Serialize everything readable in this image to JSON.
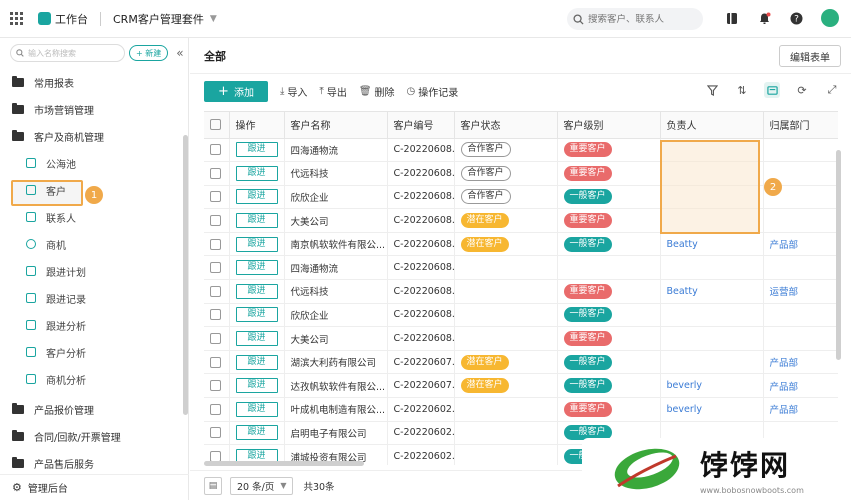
{
  "topbar": {
    "app_name": "工作台",
    "suite_name": "CRM客户管理套件",
    "search_placeholder": "搜索客户、联系人"
  },
  "sidebar": {
    "search_placeholder": "输入名称搜索",
    "new_label": "+ 新建",
    "items": [
      {
        "label": "常用报表",
        "type": "folder"
      },
      {
        "label": "市场营销管理",
        "type": "folder"
      },
      {
        "label": "客户及商机管理",
        "type": "folder"
      },
      {
        "label": "公海池",
        "type": "sub"
      },
      {
        "label": "客户",
        "type": "sub"
      },
      {
        "label": "联系人",
        "type": "sub"
      },
      {
        "label": "商机",
        "type": "sub"
      },
      {
        "label": "跟进计划",
        "type": "sub"
      },
      {
        "label": "跟进记录",
        "type": "sub"
      },
      {
        "label": "跟进分析",
        "type": "sub"
      },
      {
        "label": "客户分析",
        "type": "sub"
      },
      {
        "label": "商机分析",
        "type": "sub"
      },
      {
        "label": "产品报价管理",
        "type": "folder"
      },
      {
        "label": "合同/回款/开票管理",
        "type": "folder"
      },
      {
        "label": "产品售后服务",
        "type": "folder"
      }
    ],
    "bottom_label": "管理后台",
    "marker_1": "1"
  },
  "main": {
    "title": "全部",
    "edit_form_label": "编辑表单",
    "marker_2": "2"
  },
  "toolbar": {
    "add_label": "添加",
    "import_label": "导入",
    "export_label": "导出",
    "delete_label": "删除",
    "log_label": "操作记录"
  },
  "table": {
    "headers": [
      "操作",
      "客户名称",
      "客户编号",
      "客户状态",
      "客户级别",
      "负责人",
      "归属部门"
    ],
    "follow_label": "跟进",
    "rows": [
      {
        "name": "四海通物流",
        "code": "C-20220608...",
        "status": "合作客户",
        "status_style": "outline",
        "level": "重要客户",
        "level_style": "red",
        "owner": "",
        "dept": ""
      },
      {
        "name": "代远科技",
        "code": "C-20220608...",
        "status": "合作客户",
        "status_style": "outline",
        "level": "重要客户",
        "level_style": "red",
        "owner": "",
        "dept": ""
      },
      {
        "name": "欣欣企业",
        "code": "C-20220608...",
        "status": "合作客户",
        "status_style": "outline",
        "level": "一般客户",
        "level_style": "green",
        "owner": "",
        "dept": ""
      },
      {
        "name": "大美公司",
        "code": "C-20220608...",
        "status": "潜在客户",
        "status_style": "yellow",
        "level": "重要客户",
        "level_style": "red",
        "owner": "",
        "dept": ""
      },
      {
        "name": "南京帆软软件有限公...",
        "code": "C-20220608...",
        "status": "潜在客户",
        "status_style": "yellow",
        "level": "一般客户",
        "level_style": "green",
        "owner": "Beatty",
        "dept": "产品部"
      },
      {
        "name": "四海通物流",
        "code": "C-20220608...",
        "status": "",
        "status_style": "",
        "level": "",
        "level_style": "",
        "owner": "",
        "dept": ""
      },
      {
        "name": "代远科技",
        "code": "C-20220608...",
        "status": "",
        "status_style": "",
        "level": "重要客户",
        "level_style": "red",
        "owner": "Beatty",
        "dept": "运营部"
      },
      {
        "name": "欣欣企业",
        "code": "C-20220608...",
        "status": "",
        "status_style": "",
        "level": "一般客户",
        "level_style": "green",
        "owner": "",
        "dept": ""
      },
      {
        "name": "大美公司",
        "code": "C-20220608...",
        "status": "",
        "status_style": "",
        "level": "重要客户",
        "level_style": "red",
        "owner": "",
        "dept": ""
      },
      {
        "name": "湖滨大利药有限公司",
        "code": "C-20220607...",
        "status": "潜在客户",
        "status_style": "yellow",
        "level": "一般客户",
        "level_style": "green",
        "owner": "",
        "dept": "产品部"
      },
      {
        "name": "达孜帆软软件有限公...",
        "code": "C-20220607...",
        "status": "潜在客户",
        "status_style": "yellow",
        "level": "一般客户",
        "level_style": "green",
        "owner": "beverly",
        "dept": "产品部"
      },
      {
        "name": "叶成机电制造有限公...",
        "code": "C-20220602...",
        "status": "",
        "status_style": "",
        "level": "重要客户",
        "level_style": "red",
        "owner": "beverly",
        "dept": "产品部"
      },
      {
        "name": "启明电子有限公司",
        "code": "C-20220602...",
        "status": "",
        "status_style": "",
        "level": "一般客户",
        "level_style": "green",
        "owner": "",
        "dept": ""
      },
      {
        "name": "浦城投资有限公司",
        "code": "C-20220602...",
        "status": "",
        "status_style": "",
        "level": "一般客户",
        "level_style": "green",
        "owner": "",
        "dept": ""
      }
    ]
  },
  "footer": {
    "page_size": "20 条/页",
    "total": "共30条"
  },
  "watermark": {
    "title": "饽饽网",
    "subtitle": "www.bobosnowboots.com"
  }
}
